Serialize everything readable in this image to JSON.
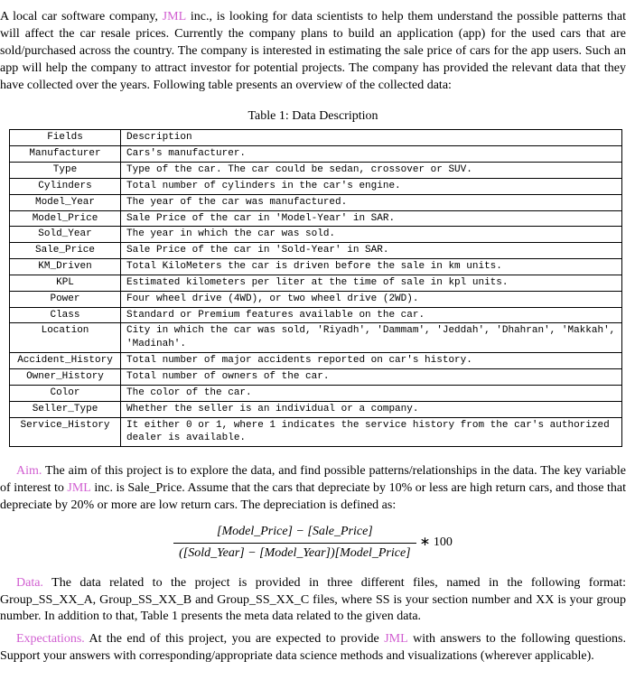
{
  "company_name": "JML",
  "intro": {
    "p1_a": "A local car software company, ",
    "p1_b": " inc., is looking for data scientists to help them understand the possible patterns that will affect the car resale prices. Currently the company plans to build an application (app) for the used cars that are sold/purchased across the country. The company is interested in estimating the sale price of cars for the app users. Such an app will help the company to attract investor for potential projects. The company has provided the relevant data that they have collected over the years. Following table presents an overview of the collected data:"
  },
  "table": {
    "caption": "Table 1: Data Description",
    "header": {
      "field": "Fields",
      "desc": "Description"
    },
    "rows": [
      {
        "field": "Manufacturer",
        "desc": "Cars's manufacturer."
      },
      {
        "field": "Type",
        "desc": "Type of the car. The car could be sedan, crossover or SUV."
      },
      {
        "field": "Cylinders",
        "desc": "Total number of cylinders in the car's engine."
      },
      {
        "field": "Model_Year",
        "desc": "The year of the car was manufactured."
      },
      {
        "field": "Model_Price",
        "desc": "Sale Price of the car in 'Model-Year' in SAR."
      },
      {
        "field": "Sold_Year",
        "desc": "The year in which the car was sold."
      },
      {
        "field": "Sale_Price",
        "desc": "Sale Price of the car in 'Sold-Year' in SAR."
      },
      {
        "field": "KM_Driven",
        "desc": "Total KiloMeters the car is driven before the sale in km units."
      },
      {
        "field": "KPL",
        "desc": "Estimated kilometers per liter at the time of sale in kpl units."
      },
      {
        "field": "Power",
        "desc": "Four wheel drive (4WD), or two wheel drive (2WD)."
      },
      {
        "field": "Class",
        "desc": "Standard or Premium features available on the car."
      },
      {
        "field": "Location",
        "desc": "City in which the car was sold, 'Riyadh', 'Dammam', 'Jeddah', 'Dhahran', 'Makkah', 'Madinah'."
      },
      {
        "field": "Accident_History",
        "desc": "Total number of major accidents reported on car's history."
      },
      {
        "field": "Owner_History",
        "desc": "Total number of owners of the car."
      },
      {
        "field": "Color",
        "desc": "The color of the car."
      },
      {
        "field": "Seller_Type",
        "desc": "Whether the seller is an individual or a company."
      },
      {
        "field": "Service_History",
        "desc": "It either 0 or 1, where 1 indicates the service history from the car's authorized dealer is available."
      }
    ]
  },
  "aim": {
    "label": "Aim.",
    "text_a": " The aim of this project is to explore the data, and find possible patterns/relationships in the data. The key variable of interest to ",
    "text_b": " inc. is Sale_Price. Assume that the cars that depreciate by 10% or less are high return cars, and those that depreciate by 20% or more are low return cars. The depreciation is defined as:"
  },
  "formula": {
    "num": "[Model_Price] − [Sale_Price]",
    "den": "([Sold_Year] − [Model_Year])[Model_Price]",
    "times": " ∗ 100"
  },
  "data_section": {
    "label": "Data.",
    "text": " The data related to the project is provided in three different files, named in the following format: Group_SS_XX_A, Group_SS_XX_B and Group_SS_XX_C files, where SS is your section number and XX is your group number. In addition to that, Table 1 presents the meta data related to the given data."
  },
  "expectations": {
    "label": "Expectations.",
    "text_a": " At the end of this project, you are expected to provide ",
    "text_b": " with answers to the following questions. Support your answers with corresponding/appropriate data science methods and visualizations (wherever applicable)."
  }
}
